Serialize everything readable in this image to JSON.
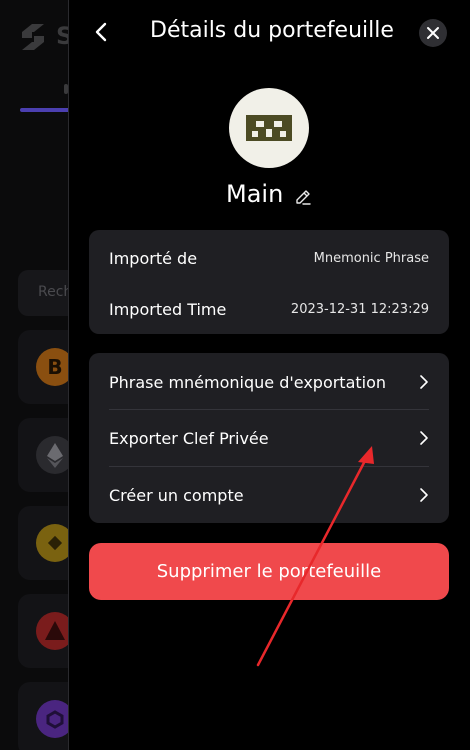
{
  "background_app": {
    "brand_initial": "S",
    "search_placeholder": "Rech",
    "coins": [
      "bitcoin-icon",
      "ethereum-icon",
      "bnb-icon",
      "avalanche-icon",
      "polygon-icon"
    ]
  },
  "header": {
    "title": "Détails du portefeuille",
    "back_icon": "chevron-left-icon",
    "close_icon": "close-icon"
  },
  "wallet": {
    "name": "Main",
    "edit_icon": "pencil-icon",
    "avatar_icon": "wallet-avatar-icon"
  },
  "info": {
    "imported_from_label": "Importé de",
    "imported_from_value": "Mnemonic Phrase",
    "imported_time_label": "Imported Time",
    "imported_time_value": "2023-12-31 12:23:29"
  },
  "actions": [
    {
      "label": "Phrase mnémonique d'exportation"
    },
    {
      "label": "Exporter Clef Privée"
    },
    {
      "label": "Créer un compte"
    }
  ],
  "delete_button": {
    "label": "Supprimer le portefeuille"
  },
  "colors": {
    "panel_bg": "#000000",
    "card_bg": "#1f1f23",
    "danger": "#f0494c",
    "annotation_arrow": "#e8282b"
  }
}
